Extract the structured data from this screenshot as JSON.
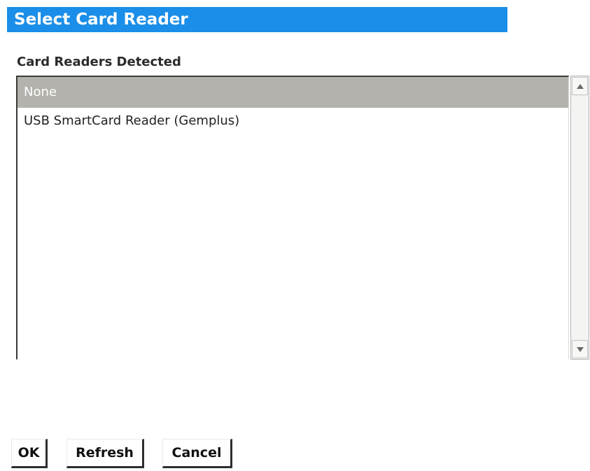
{
  "dialog": {
    "title": "Select Card Reader",
    "section_label": "Card Readers Detected"
  },
  "reader_list": {
    "items": [
      {
        "label": "None",
        "selected": true
      },
      {
        "label": "USB SmartCard Reader (Gemplus)",
        "selected": false
      }
    ]
  },
  "scrollbar": {
    "up_icon": "arrow-up-icon",
    "down_icon": "arrow-down-icon"
  },
  "buttons": {
    "ok_label": "OK",
    "refresh_label": "Refresh",
    "cancel_label": "Cancel"
  },
  "colors": {
    "title_bar": "#1a8ee8",
    "selected_row": "#b3b2ac"
  }
}
